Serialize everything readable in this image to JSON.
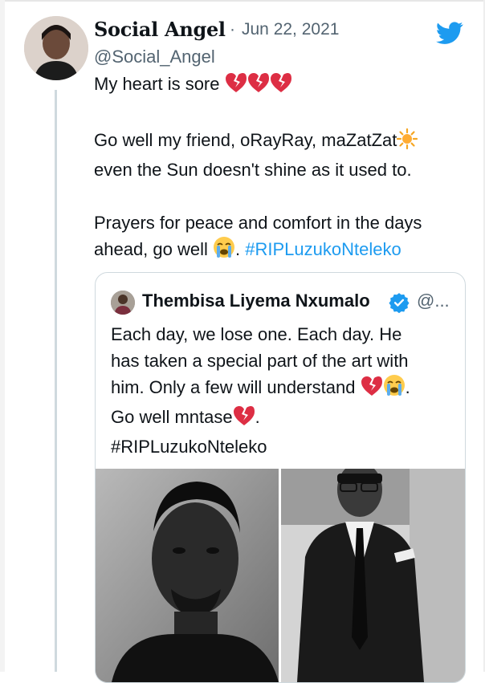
{
  "author": {
    "name": "Social Angel",
    "handle": "@Social_Angel",
    "date": "Jun 22, 2021",
    "date_separator": "·"
  },
  "tweet": {
    "line1": "My heart is sore ",
    "line2a": "Go well my friend, oRayRay, maZatZat",
    "line2b": "even the Sun doesn't shine as it used to.",
    "line3a": "Prayers for peace and comfort in the days",
    "line3b": "ahead, go well ",
    "line3c": ". ",
    "hashtag": "#RIPLuzukoNteleko"
  },
  "quoted": {
    "name": "Thembisa Liyema Nxumalo",
    "handle": "@...",
    "line1": "Each day, we lose one. Each day. He",
    "line2": "has taken a special part of the art with",
    "line3": "him. Only a few will understand ",
    "line3_end": ".",
    "line4": "Go well mntase",
    "line4_end": ".",
    "hashtag": "#RIPLuzukoNteleko"
  },
  "icons": {
    "logo": "twitter-bird-icon",
    "verified": "verified-badge-icon",
    "broken_heart": "broken-heart-emoji",
    "sun": "sun-emoji",
    "crying": "loudly-crying-face-emoji"
  },
  "colors": {
    "accent": "#1d9bf0",
    "text": "#0f1419",
    "muted": "#536471",
    "border": "#cfd9de",
    "broken_heart": "#dd2e44"
  }
}
